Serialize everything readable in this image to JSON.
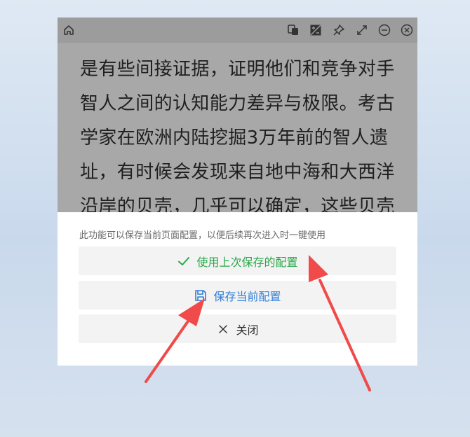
{
  "article": {
    "lines": [
      "是有些间接证据，证明他们和竞争对手",
      "智人之间的认知能力差异与极限。考古",
      "学家在欧洲内陆挖掘3万年前的智人遗",
      "址，有时候会发现来自地中海和大西洋",
      "沿岸的贝壳，几乎可以确定，这些贝壳"
    ]
  },
  "panel": {
    "hint": "此功能可以保存当前页面配置，以便后续再次进入时一键使用",
    "use_last_label": "使用上次保存的配置",
    "save_current_label": "保存当前配置",
    "close_label": "关闭"
  },
  "colors": {
    "accent_green": "#2aa84a",
    "accent_blue": "#2f7dd6",
    "arrow_red": "#f04a4a",
    "titlebar": "#9c9c9c"
  },
  "icons": {
    "titlebar": [
      "home-icon",
      "copy-icon",
      "image-edit-icon",
      "pin-icon",
      "expand-icon",
      "minimize-icon",
      "close-icon"
    ]
  }
}
